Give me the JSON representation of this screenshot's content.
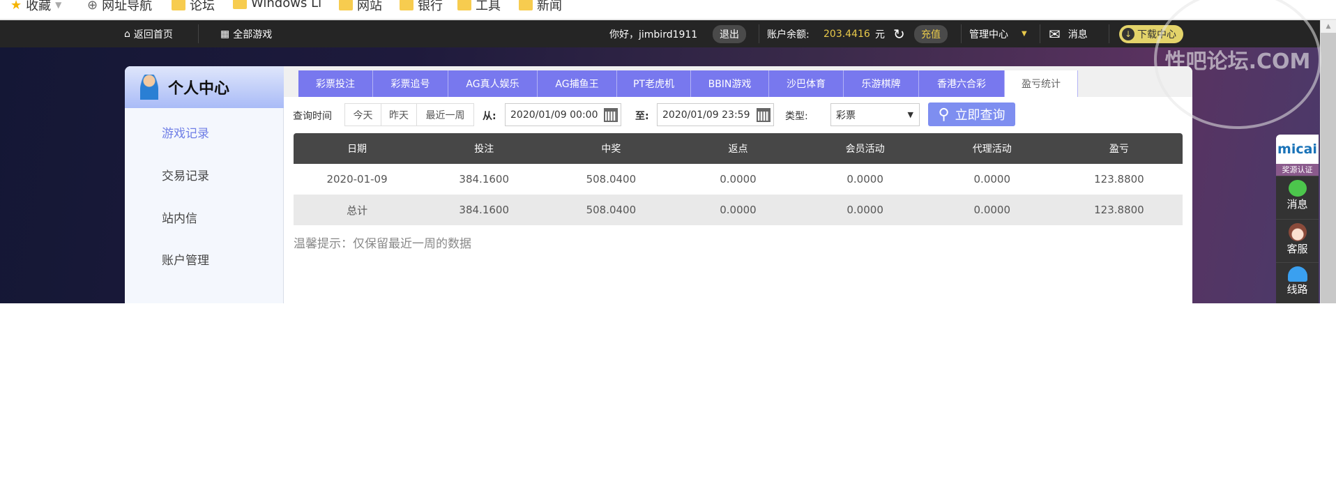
{
  "bookmarks": [
    "收藏",
    "网址导航",
    "论坛",
    "Windows Li",
    "网站",
    "银行",
    "工具",
    "新闻"
  ],
  "nav": {
    "home": "返回首页",
    "all_games": "全部游戏",
    "greeting": "你好，jimbird1911",
    "logout": "退出",
    "balance_label": "账户余额:",
    "balance": "203.4416",
    "currency": "元",
    "recharge": "充值",
    "manage": "管理中心",
    "messages": "消息",
    "download": "下载中心"
  },
  "sidebar": {
    "title": "个人中心",
    "items": [
      {
        "label": "游戏记录",
        "active": true
      },
      {
        "label": "交易记录"
      },
      {
        "label": "站内信"
      },
      {
        "label": "账户管理"
      }
    ]
  },
  "tabs": [
    "彩票投注",
    "彩票追号",
    "AG真人娱乐",
    "AG捕鱼王",
    "PT老虎机",
    "BBIN游戏",
    "沙巴体育",
    "乐游棋牌",
    "香港六合彩",
    "盈亏统计"
  ],
  "active_tab": "盈亏统计",
  "filter": {
    "label": "查询时间",
    "quick": [
      "今天",
      "昨天",
      "最近一周"
    ],
    "from_label": "从:",
    "from": "2020/01/09 00:00",
    "to_label": "至:",
    "to": "2020/01/09 23:59",
    "type_label": "类型:",
    "type": "彩票",
    "search": "立即查询"
  },
  "table": {
    "headers": [
      "日期",
      "投注",
      "中奖",
      "返点",
      "会员活动",
      "代理活动",
      "盈亏"
    ],
    "rows": [
      [
        "2020-01-09",
        "384.1600",
        "508.0400",
        "0.0000",
        "0.0000",
        "0.0000",
        "123.8800"
      ],
      [
        "总计",
        "384.1600",
        "508.0400",
        "0.0000",
        "0.0000",
        "0.0000",
        "123.8800"
      ]
    ]
  },
  "tip": "温馨提示：仅保留最近一周的数据",
  "float": {
    "logo": "micai",
    "cert": "奖源认证",
    "items": [
      "消息",
      "客服",
      "线路"
    ]
  },
  "watermark": "性吧论坛.COM",
  "colors": {
    "tab": "#7878ee",
    "balance": "#e8c94a",
    "nav": "#252525"
  }
}
